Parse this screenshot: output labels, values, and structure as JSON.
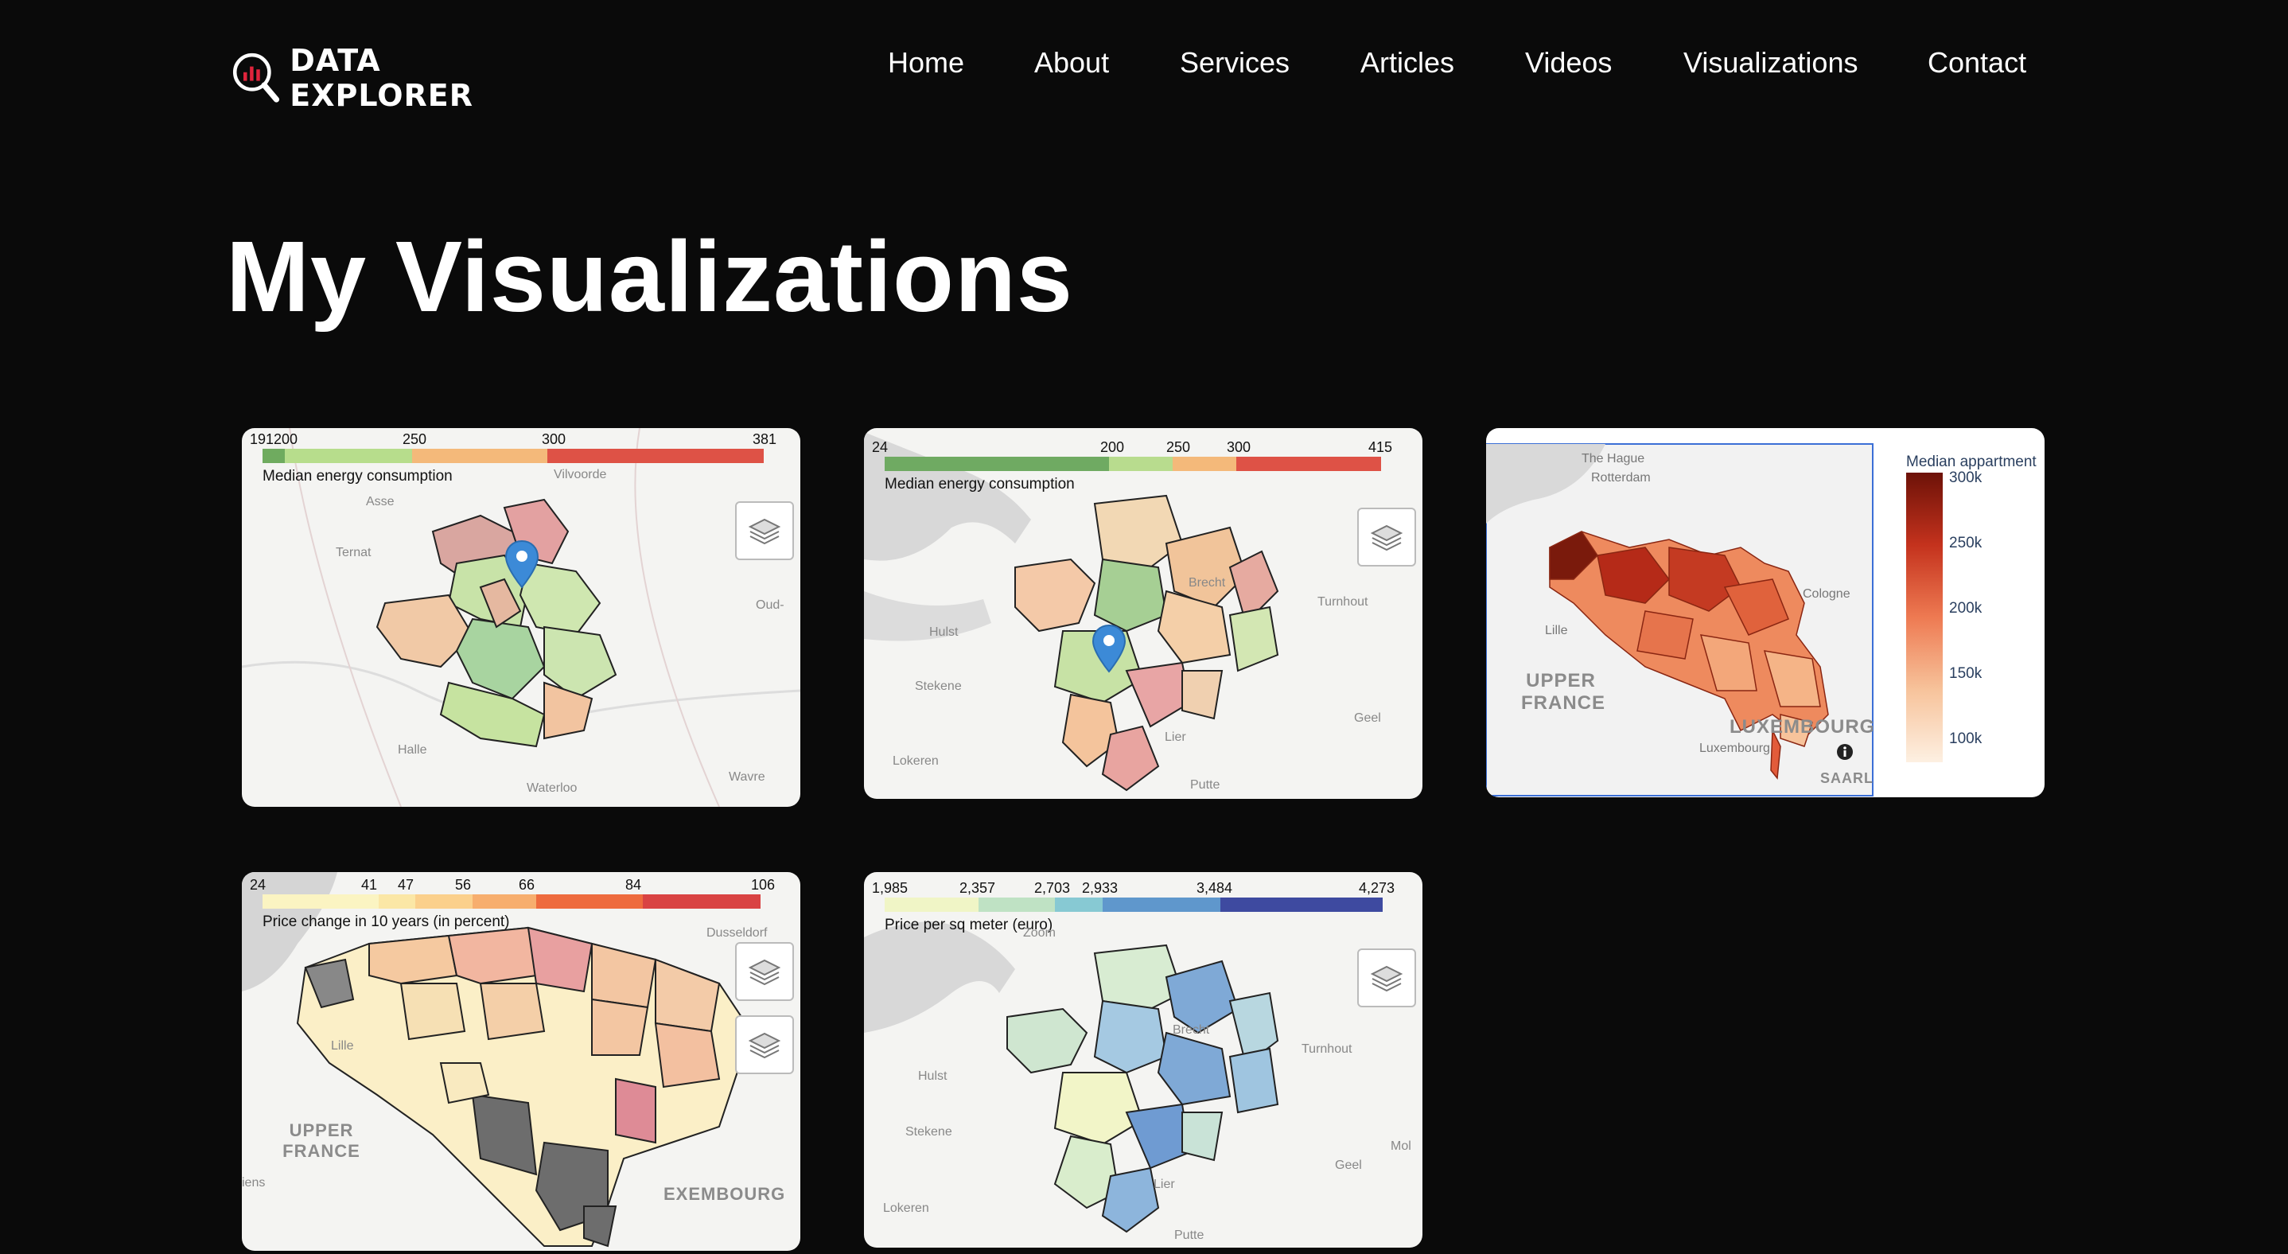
{
  "site": {
    "logo_text": "DATA EXPLORER"
  },
  "nav": [
    {
      "label": "Home"
    },
    {
      "label": "About"
    },
    {
      "label": "Services"
    },
    {
      "label": "Articles"
    },
    {
      "label": "Videos"
    },
    {
      "label": "Visualizations"
    },
    {
      "label": "Contact"
    }
  ],
  "page": {
    "title": "My Visualizations"
  },
  "colors": {
    "background": "#0a0a0a",
    "card": "#f4f4f2",
    "text": "#ffffff"
  },
  "cards": [
    {
      "colorbar": {
        "ticks": [
          "191200",
          "250",
          "300",
          "381"
        ],
        "title": "Median energy consumption"
      },
      "places": [
        "Asse",
        "Ternat",
        "Vilvoorde",
        "Halle",
        "Waterloo",
        "Wavre",
        "Oud-"
      ]
    },
    {
      "colorbar": {
        "ticks": [
          "24",
          "200",
          "250",
          "300",
          "415"
        ],
        "title": "Median energy consumption"
      },
      "places": [
        "Hulst",
        "Stekene",
        "Lokeren",
        "Turnhout",
        "Geel",
        "Lier",
        "Putte",
        "Brecht"
      ]
    },
    {
      "legend": {
        "title": "Median appartment",
        "ticks": [
          "300k",
          "250k",
          "200k",
          "150k",
          "100k"
        ]
      },
      "places": [
        "The Hague",
        "Rotterdam",
        "Lille",
        "Cologne",
        "UPPER FRANCE",
        "LUXEMBOURG",
        "Luxembourg",
        "SAARL"
      ]
    },
    {
      "colorbar": {
        "ticks": [
          "24",
          "41",
          "47",
          "56",
          "66",
          "84",
          "106"
        ],
        "title": "Price change in 10 years (in percent)"
      },
      "places": [
        "Lille",
        "UPPER FRANCE",
        "Dusseldorf",
        "EXEMBOURG",
        "iens"
      ]
    },
    {
      "colorbar": {
        "ticks": [
          "1,985",
          "2,357",
          "2,703",
          "2,933",
          "3,484",
          "4,273"
        ],
        "title": "Price per sq meter (euro)"
      },
      "places": [
        "Hulst",
        "Stekene",
        "Lokeren",
        "Turnhout",
        "Geel",
        "Lier",
        "Putte",
        "Brecht",
        "Mol",
        "Zoom"
      ]
    }
  ]
}
